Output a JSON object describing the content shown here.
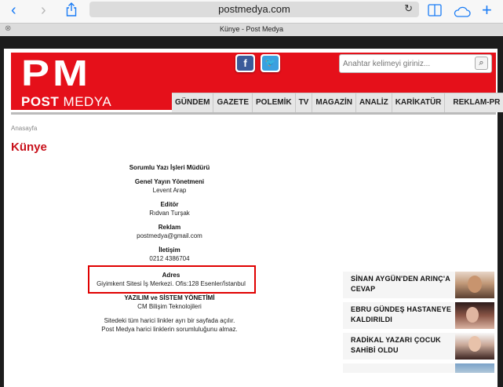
{
  "browser": {
    "url": "postmedya.com",
    "tab_title": "Künye - Post Medya",
    "icons": [
      "back-icon",
      "forward-icon",
      "share-icon",
      "reload-icon",
      "bookmarks-icon",
      "cloud-icon",
      "new-tab-icon",
      "close-tab-icon"
    ]
  },
  "header": {
    "logo_main": "PM",
    "logo_sub_bold": "POST",
    "logo_sub_light": "MEDYA",
    "social": [
      "facebook-icon",
      "twitter-icon"
    ],
    "search_placeholder": "Anahtar kelimeyi giriniz...",
    "brand_color": "#e5101a"
  },
  "nav": {
    "items": [
      "GÜNDEM",
      "GAZETE",
      "POLEMİK",
      "TV",
      "MAGAZİN",
      "ANALİZ",
      "KARİKATÜR",
      "REKLAM-PR"
    ]
  },
  "page": {
    "breadcrumb": "Anasayfa",
    "title": "Künye"
  },
  "kunye": {
    "sorumlu": "Sorumlu Yazı İşleri Müdürü",
    "genel_title": "Genel Yayın Yönetmeni",
    "genel_value": "Levent Arap",
    "editor_title": "Editör",
    "editor_value": "Rıdvan Turşak",
    "reklam_title": "Reklam",
    "reklam_value": "postmedya@gmail.com",
    "iletisim_title": "İletişim",
    "iletisim_value": "0212 4386704",
    "adres_title": "Adres",
    "adres_value": "Giyimkent Sitesi İş Merkezi. Ofis:128 Esenler/İstanbul",
    "yazilim_title": "YAZILIM ve SİSTEM YÖNETİMİ",
    "yazilim_value": "CM Bilişim Teknolojileri",
    "note1": "Sitedeki tüm harici linkler ayrı bir sayfada açılır.",
    "note2": "Post Medya harici linklerin sorumluluğunu almaz."
  },
  "news": [
    {
      "title": "SİNAN AYGÜN'DEN ARINÇ'A CEVAP"
    },
    {
      "title": "EBRU GÜNDEŞ HASTANEYE KALDIRILDI"
    },
    {
      "title": "RADİKAL YAZARI ÇOCUK SAHİBİ OLDU"
    }
  ]
}
